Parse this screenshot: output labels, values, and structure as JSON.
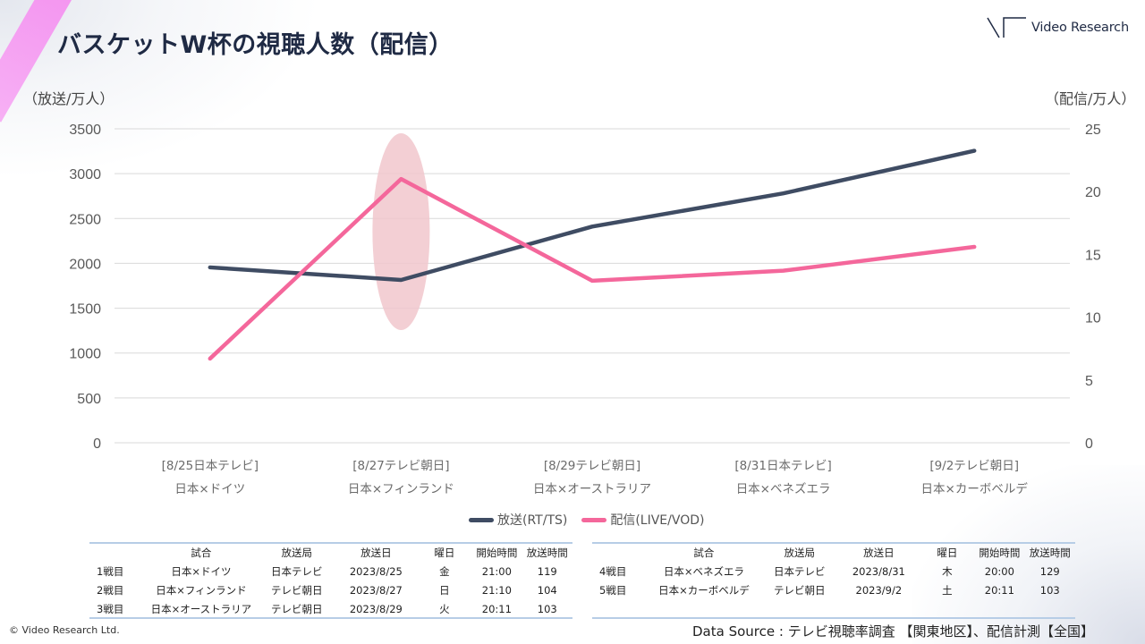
{
  "page": {
    "title": "バスケットW杯の視聴人数（配信）",
    "logo_text": "Video Research",
    "left_axis_unit": "（放送/万人）",
    "right_axis_unit": "（配信/万人）",
    "copyright": "© Video Research  Ltd.",
    "source": "Data Source : テレビ視聴率調査 【関東地区】、配信計測【全国】"
  },
  "colors": {
    "broadcast": "#3f4c63",
    "streaming": "#f4679b",
    "highlight": "#f1c7cc",
    "grid": "#d9d9d9"
  },
  "chart_data": {
    "type": "line",
    "title": "バスケットW杯の視聴人数（配信）",
    "categories": [
      [
        "[8/25日本テレビ]",
        "日本×ドイツ"
      ],
      [
        "[8/27テレビ朝日]",
        "日本×フィンランド"
      ],
      [
        "[8/29テレビ朝日]",
        "日本×オーストラリア"
      ],
      [
        "[8/31日本テレビ]",
        "日本×ベネズエラ"
      ],
      [
        "[9/2テレビ朝日]",
        "日本×カーボベルデ"
      ]
    ],
    "series": [
      {
        "name": "放送(RT/TS)",
        "axis": "left",
        "values": [
          1955,
          1815,
          2410,
          2780,
          3255
        ]
      },
      {
        "name": "配信(LIVE/VOD)",
        "axis": "right",
        "values": [
          6.7,
          21.0,
          12.9,
          13.7,
          15.6
        ]
      }
    ],
    "left_axis": {
      "label": "（放送/万人）",
      "ylim": [
        0,
        3500
      ],
      "ticks": [
        0,
        500,
        1000,
        1500,
        2000,
        2500,
        3000,
        3500
      ]
    },
    "right_axis": {
      "label": "（配信/万人）",
      "ylim": [
        0,
        25
      ],
      "ticks": [
        0,
        5,
        10,
        15,
        20,
        25
      ]
    },
    "grid": true,
    "legend": "bottom",
    "highlight_category_index": 1
  },
  "tables": [
    {
      "headers": [
        "",
        "試合",
        "放送局",
        "放送日",
        "曜日",
        "開始時間",
        "放送時間"
      ],
      "rows": [
        [
          "1戦目",
          "日本×ドイツ",
          "日本テレビ",
          "2023/8/25",
          "金",
          "21:00",
          "119"
        ],
        [
          "2戦目",
          "日本×フィンランド",
          "テレビ朝日",
          "2023/8/27",
          "日",
          "21:10",
          "104"
        ],
        [
          "3戦目",
          "日本×オーストラリア",
          "テレビ朝日",
          "2023/8/29",
          "火",
          "20:11",
          "103"
        ]
      ]
    },
    {
      "headers": [
        "",
        "試合",
        "放送局",
        "放送日",
        "曜日",
        "開始時間",
        "放送時間"
      ],
      "rows": [
        [
          "4戦目",
          "日本×ベネズエラ",
          "日本テレビ",
          "2023/8/31",
          "木",
          "20:00",
          "129"
        ],
        [
          "5戦目",
          "日本×カーボベルデ",
          "テレビ朝日",
          "2023/9/2",
          "土",
          "20:11",
          "103"
        ]
      ]
    }
  ]
}
